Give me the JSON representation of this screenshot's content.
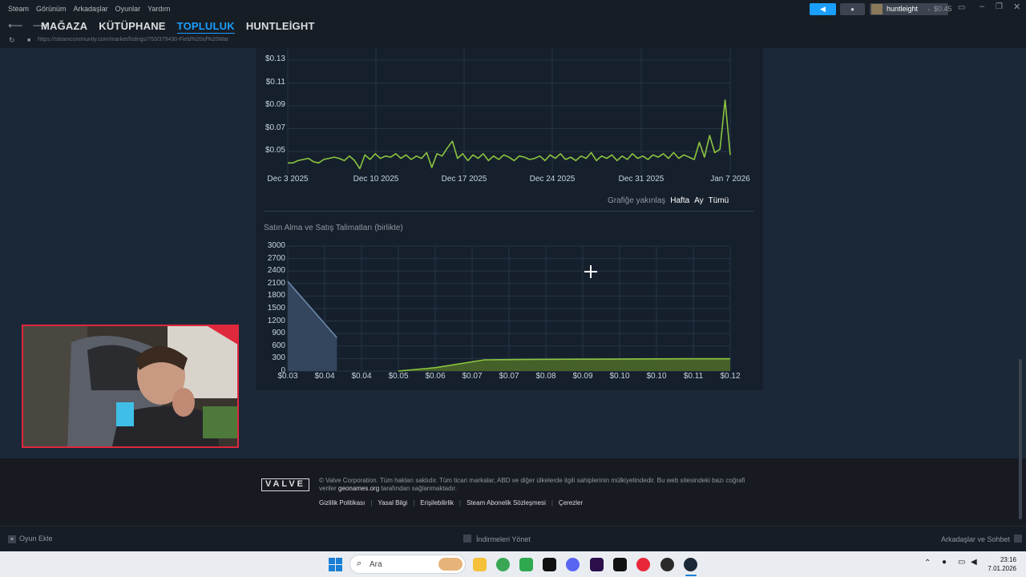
{
  "titlebar": {
    "menu": [
      "Steam",
      "Görünüm",
      "Arkadaşlar",
      "Oyunlar",
      "Yardım"
    ],
    "username": "huntleight",
    "balance": "$0.45"
  },
  "nav": {
    "tabs": [
      "MAĞAZA",
      "KÜTÜPHANE",
      "TOPLULUK",
      "HUNTLEİGHT"
    ],
    "active_tab": "TOPLULUK",
    "url": "https://steamcommunity.com/market/listings/753/379430-Field%20of%20War"
  },
  "price_chart": {
    "y_ticks": [
      "$0.13",
      "$0.11",
      "$0.09",
      "$0.07",
      "$0.05"
    ],
    "x_ticks": [
      "Dec 3 2025",
      "Dec 10 2025",
      "Dec 17 2025",
      "Dec 24 2025",
      "Dec 31 2025",
      "Jan 7 2026"
    ],
    "zoom_label": "Grafiğe yakınlaş",
    "zoom_options": [
      "Hafta",
      "Ay",
      "Tümü"
    ]
  },
  "order_chart": {
    "title": "Satın Alma ve Satış Talimatları (birlikte)",
    "y_ticks": [
      "3000",
      "2700",
      "2400",
      "2100",
      "1800",
      "1500",
      "1200",
      "900",
      "600",
      "300",
      "0"
    ],
    "x_ticks": [
      "$0.03",
      "$0.04",
      "$0.04",
      "$0.05",
      "$0.06",
      "$0.07",
      "$0.07",
      "$0.08",
      "$0.09",
      "$0.10",
      "$0.10",
      "$0.11",
      "$0.12"
    ]
  },
  "chart_data": [
    {
      "type": "line",
      "title": "",
      "xlabel": "",
      "ylabel": "",
      "x_range": [
        "2025-12-03",
        "2026-01-07"
      ],
      "ylim": [
        0.03,
        0.14
      ],
      "grid": true,
      "series": [
        {
          "color": "#8bc53f",
          "values": [
            0.04,
            0.04,
            0.042,
            0.043,
            0.044,
            0.041,
            0.04,
            0.043,
            0.044,
            0.045,
            0.044,
            0.042,
            0.046,
            0.042,
            0.035,
            0.047,
            0.043,
            0.048,
            0.044,
            0.046,
            0.045,
            0.048,
            0.044,
            0.047,
            0.043,
            0.046,
            0.044,
            0.049,
            0.036,
            0.048,
            0.046,
            0.053,
            0.059,
            0.044,
            0.048,
            0.042,
            0.047,
            0.044,
            0.048,
            0.042,
            0.046,
            0.043,
            0.047,
            0.045,
            0.042,
            0.046,
            0.045,
            0.043,
            0.044,
            0.046,
            0.042,
            0.047,
            0.044,
            0.048,
            0.043,
            0.045,
            0.042,
            0.046,
            0.044,
            0.049,
            0.042,
            0.046,
            0.044,
            0.047,
            0.042,
            0.046,
            0.043,
            0.048,
            0.044,
            0.046,
            0.043,
            0.047,
            0.045,
            0.048,
            0.044,
            0.049,
            0.044,
            0.047,
            0.045,
            0.043,
            0.058,
            0.045,
            0.064,
            0.049,
            0.052,
            0.095,
            0.047
          ]
        }
      ]
    },
    {
      "type": "area",
      "title": "Satın Alma ve Satış Talimatları (birlikte)",
      "xlabel": "",
      "ylabel": "",
      "xlim": [
        0.03,
        0.12
      ],
      "ylim": [
        0,
        3000
      ],
      "grid": true,
      "series": [
        {
          "color": "#6b8aaa",
          "x": [
            0.03,
            0.04
          ],
          "values": [
            2150,
            800
          ]
        },
        {
          "color": "#8bc53f",
          "x": [
            0.0525,
            0.06,
            0.07,
            0.08,
            0.09,
            0.1,
            0.11,
            0.12
          ],
          "values": [
            0,
            80,
            270,
            280,
            285,
            290,
            295,
            295
          ]
        }
      ]
    }
  ],
  "footer": {
    "logo": "VALVE",
    "copyright_1": "© Valve Corporation. Tüm hakları saklıdır. Tüm ticari markalar, ABD ve diğer ülkelerde ilgili sahiplerinin mülkiyetindedir. Bu web sitesindeki bazı coğrafi",
    "copyright_2a": "veriler ",
    "copyright_2_link": "geonames.org",
    "copyright_2b": " tarafından sağlanmaktadır.",
    "links": [
      "Gizlilik Politikası",
      "Yasal Bilgi",
      "Erişilebilirlik",
      "Steam Abonelik Sözleşmesi",
      "Çerezler"
    ]
  },
  "bottombar": {
    "add_game": "Oyun Ekle",
    "downloads": "İndirmeleri Yönet",
    "friends": "Arkadaşlar ve Sohbet"
  },
  "taskbar": {
    "search_placeholder": "Ara",
    "time": "23:16",
    "date": "7.01.2026"
  }
}
